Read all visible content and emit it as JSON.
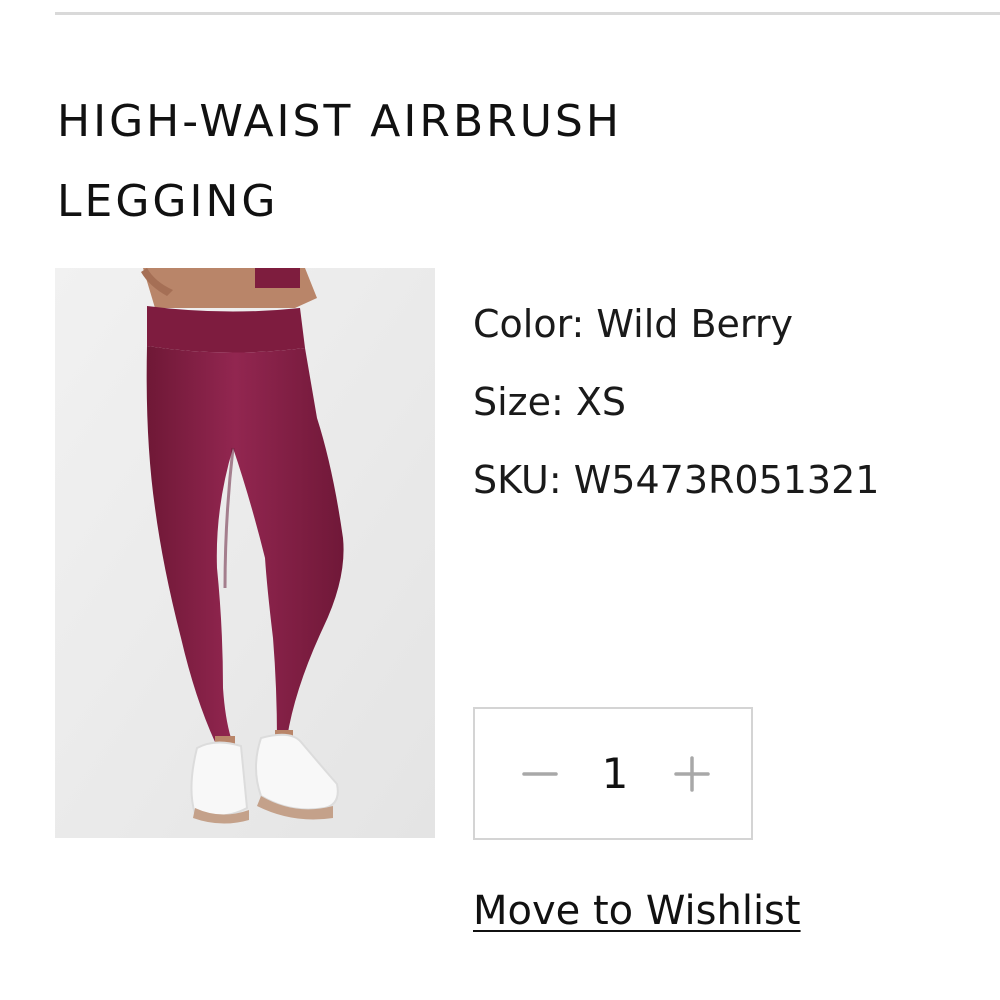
{
  "product": {
    "title": "HIGH-WAIST AIRBRUSH LEGGING",
    "image_alt": "product-photo-legging",
    "color_line": "Color: Wild Berry",
    "size_line": "Size: XS",
    "sku_line": "SKU: W5473R051321"
  },
  "quantity": {
    "value": "1",
    "decrement_icon": "minus-icon",
    "increment_icon": "plus-icon"
  },
  "actions": {
    "wishlist_label": "Move to Wishlist"
  },
  "colors": {
    "berry": "#8a2146",
    "border": "#d4d4d4",
    "divider": "#d9d9d9",
    "stepper_icon": "#a8a8a8"
  }
}
